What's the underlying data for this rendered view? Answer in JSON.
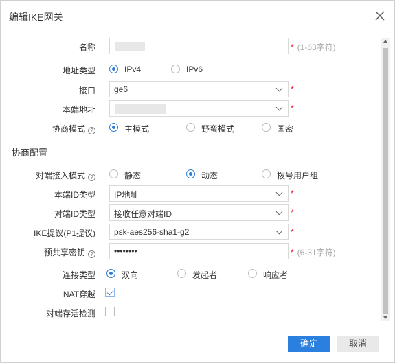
{
  "dialog": {
    "title": "编辑IKE网关",
    "close_icon": "close-icon"
  },
  "form": {
    "name": {
      "label": "名称",
      "value": "",
      "required": "*",
      "hint": "(1-63字符)"
    },
    "address_type": {
      "label": "地址类型",
      "options": [
        "IPv4",
        "IPv6"
      ],
      "selected": "IPv4"
    },
    "interface": {
      "label": "接口",
      "value": "ge6",
      "required": "*"
    },
    "local_address": {
      "label": "本端地址",
      "value": "",
      "required": "*"
    },
    "negotiation_mode": {
      "label": "协商模式",
      "help_icon": "?",
      "options": [
        "主模式",
        "野蛮模式",
        "国密"
      ],
      "selected": "主模式"
    }
  },
  "negotiation": {
    "section_title": "协商配置",
    "peer_access_mode": {
      "label": "对端接入模式",
      "help_icon": "?",
      "options": [
        "静态",
        "动态",
        "拨号用户组"
      ],
      "selected": "动态"
    },
    "local_id_type": {
      "label": "本端ID类型",
      "value": "IP地址",
      "required": "*"
    },
    "peer_id_type": {
      "label": "对端ID类型",
      "value": "接收任意对端ID",
      "required": "*"
    },
    "ike_proposal": {
      "label": "IKE提议(P1提议)",
      "value": "psk-aes256-sha1-g2",
      "required": "*"
    },
    "psk": {
      "label": "预共享密钥",
      "help_icon": "?",
      "value": "••••••••",
      "required": "*",
      "hint": "(6-31字符)"
    },
    "connection_type": {
      "label": "连接类型",
      "options": [
        "双向",
        "发起者",
        "响应者"
      ],
      "selected": "双向"
    },
    "nat_traversal": {
      "label": "NAT穿越",
      "checked": true
    },
    "dpd": {
      "label": "对端存活检测",
      "checked": false
    }
  },
  "footer": {
    "ok_label": "确定",
    "cancel_label": "取消"
  },
  "colors": {
    "accent": "#2b7fde",
    "required": "#ee2233",
    "hint": "#aaaaaa"
  }
}
